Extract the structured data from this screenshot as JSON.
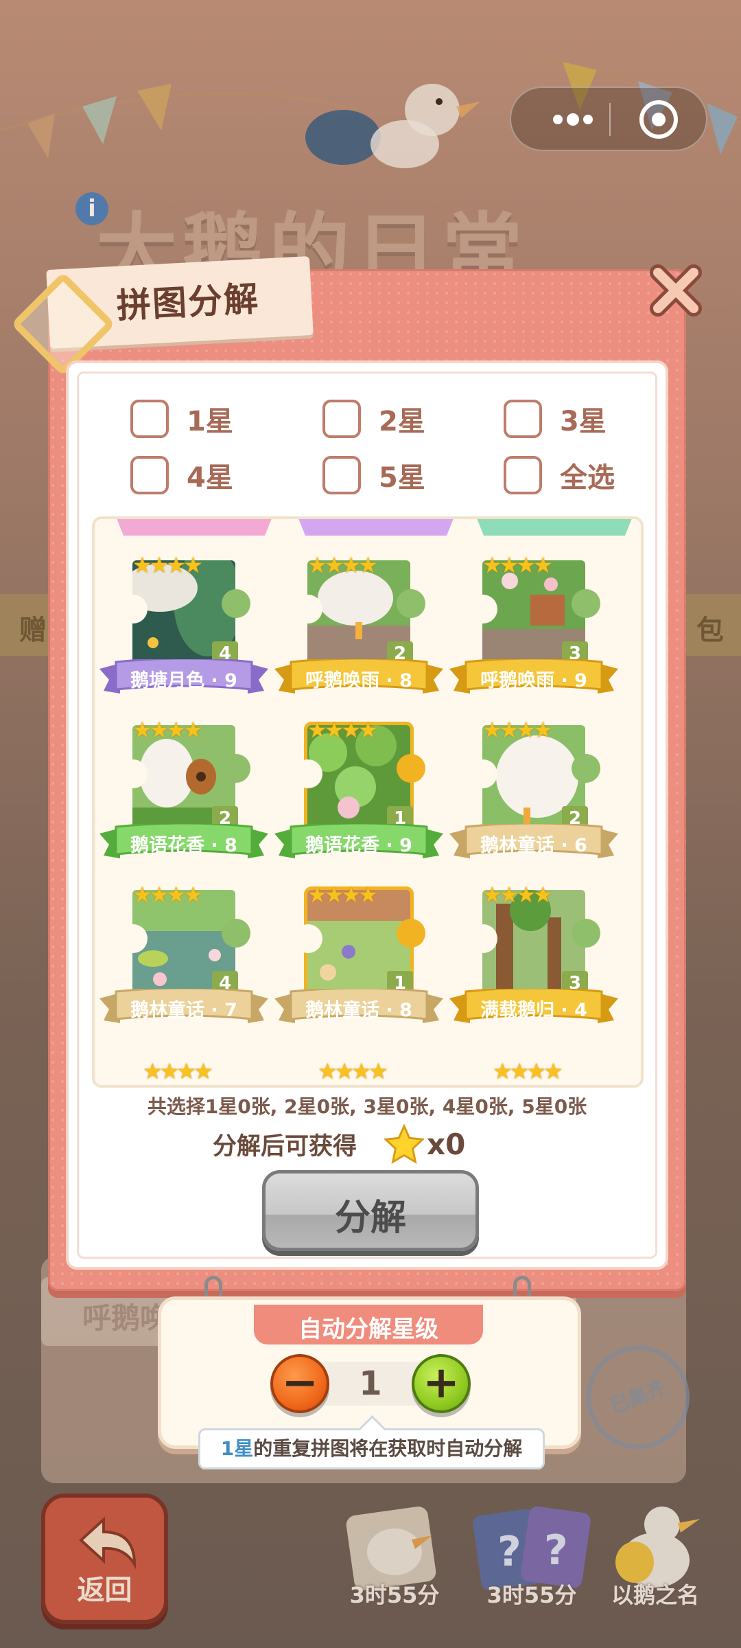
{
  "background": {
    "game_title": "大鹅的日常",
    "side_text_left": "赠",
    "side_text_right": "包",
    "album_label": "呼鹅唤",
    "stamp_text": "已集齐",
    "back_label": "返回",
    "bottom_cards": [
      {
        "label": "3时55分"
      },
      {
        "label": "3时55分"
      },
      {
        "label": "以鹅之名"
      }
    ]
  },
  "dialog": {
    "title": "拼图分解",
    "filters": [
      {
        "label": "1星",
        "checked": false
      },
      {
        "label": "2星",
        "checked": false
      },
      {
        "label": "3星",
        "checked": false
      },
      {
        "label": "4星",
        "checked": false
      },
      {
        "label": "5星",
        "checked": false
      },
      {
        "label": "全选",
        "checked": false
      }
    ],
    "pieces": [
      {
        "name": "鹅塘月色 · 9",
        "stars": "★★★★",
        "count": "4",
        "banner_color": "#b59be6",
        "banner_dark": "#8a6cc8",
        "art": "pond",
        "gold": false
      },
      {
        "name": "呼鹅唤雨 · 8",
        "stars": "★★★★",
        "count": "2",
        "banner_color": "#f5c63a",
        "banner_dark": "#d69a14",
        "art": "goose-wall",
        "gold": false
      },
      {
        "name": "呼鹅唤雨 · 9",
        "stars": "★★★★",
        "count": "3",
        "banner_color": "#f5c63a",
        "banner_dark": "#d69a14",
        "art": "flowers-wall",
        "gold": false
      },
      {
        "name": "鹅语花香 · 8",
        "stars": "★★★★",
        "count": "2",
        "banner_color": "#86d86a",
        "banner_dark": "#54ad3a",
        "art": "guitar",
        "gold": false
      },
      {
        "name": "鹅语花香 · 9",
        "stars": "★★★★",
        "count": "1",
        "banner_color": "#86d86a",
        "banner_dark": "#54ad3a",
        "art": "leaves",
        "gold": true
      },
      {
        "name": "鹅林童话 · 6",
        "stars": "★★★★",
        "count": "2",
        "banner_color": "#ecd29a",
        "banner_dark": "#c7a766",
        "art": "goose-back",
        "gold": false
      },
      {
        "name": "鹅林童话 · 7",
        "stars": "★★★★",
        "count": "4",
        "banner_color": "#ecd29a",
        "banner_dark": "#c7a766",
        "art": "lily",
        "gold": false
      },
      {
        "name": "鹅林童话 · 8",
        "stars": "★★★★",
        "count": "1",
        "banner_color": "#ecd29a",
        "banner_dark": "#c7a766",
        "art": "meadow",
        "gold": true
      },
      {
        "name": "满载鹅归 · 4",
        "stars": "★★★★",
        "count": "3",
        "banner_color": "#f5c63a",
        "banner_dark": "#d69a14",
        "art": "trees",
        "gold": false
      }
    ],
    "summary": "共选择1星0张, 2星0张, 3星0张, 4星0张, 5星0张",
    "reward_label": "分解后可获得",
    "reward_count": "x0",
    "decompose_label": "分解"
  },
  "auto": {
    "title": "自动分解星级",
    "level": "1",
    "minus": "−",
    "plus": "+",
    "tip_highlight": "1星",
    "tip_rest": "的重复拼图将在获取时自动分解"
  },
  "colors": {
    "modal": "#ec8f80",
    "accent_highlight": "#3f8ec5"
  }
}
